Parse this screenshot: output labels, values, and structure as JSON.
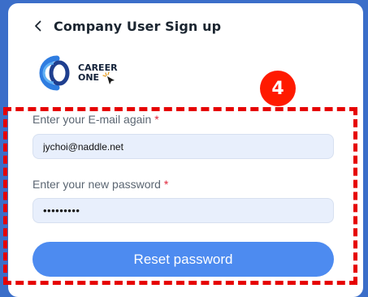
{
  "header": {
    "back_icon": "chevron-left-icon",
    "title": "Company User Sign up"
  },
  "logo": {
    "line1": "CAREER",
    "line2": "ONE",
    "icon": "cursor-click-icon"
  },
  "annotation": {
    "step_number": "4",
    "color": "#e60000"
  },
  "form": {
    "email_again_label": "Enter your E-mail again",
    "email_again_value": "jychoi@naddle.net",
    "new_password_label": "Enter your new password",
    "new_password_value": "•••••••••",
    "required_mark": "*",
    "submit_label": "Reset password"
  },
  "colors": {
    "primary": "#4d8bf0",
    "input_bg": "#e8effc",
    "required": "#e0263b",
    "background": "#3b6ec9"
  }
}
